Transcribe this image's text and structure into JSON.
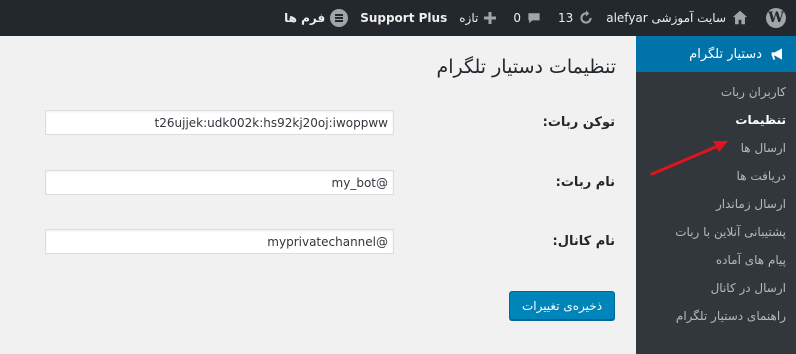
{
  "admin_bar": {
    "site_name": "سایت آموزشی alefyar",
    "updates_count": "13",
    "comments_count": "0",
    "new_label": "تازه",
    "support_label": "Support Plus",
    "forms_label": "فرم ها"
  },
  "sidebar": {
    "menu_title": "دستیار تلگرام",
    "items": [
      {
        "label": "کاربران ربات"
      },
      {
        "label": "تنظیمات"
      },
      {
        "label": "ارسال ها"
      },
      {
        "label": "دریافت ها"
      },
      {
        "label": "ارسال زماندار"
      },
      {
        "label": "پشتیبانی آنلاین با ربات"
      },
      {
        "label": "پیام های آماده"
      },
      {
        "label": "ارسال در کانال"
      },
      {
        "label": "راهنمای دستیار تلگرام"
      }
    ],
    "current_index": 1
  },
  "page": {
    "title": "تنظیمات دستیار تلگرام",
    "fields": [
      {
        "label": "توکن ربات:",
        "value": "t26ujjek:udk002k:hs92kj20oj:iwoppww"
      },
      {
        "label": "نام ربات:",
        "value": "@my_bot"
      },
      {
        "label": "نام کانال:",
        "value": "@myprivatechannel"
      }
    ],
    "save_label": "ذخیره‌ی تغییرات"
  },
  "colors": {
    "admin_bar": "#23282d",
    "accent": "#0073aa",
    "button": "#0085ba",
    "annotation_arrow": "#e0141e"
  }
}
